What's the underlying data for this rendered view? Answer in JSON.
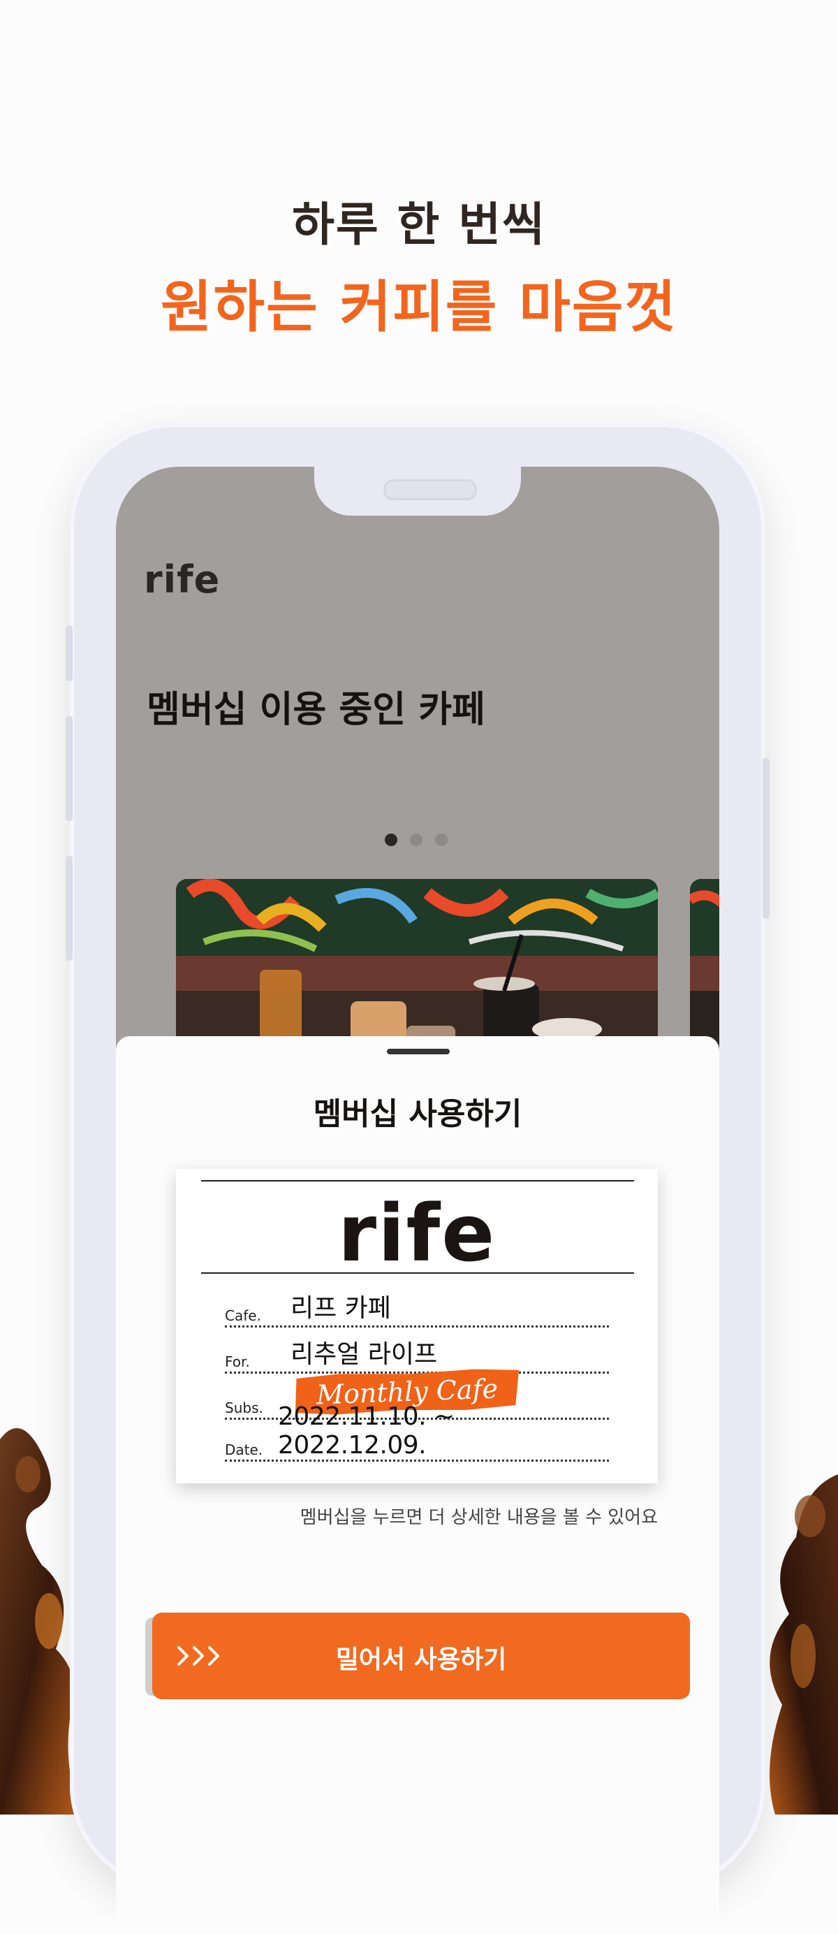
{
  "headline": {
    "line1": "하루 한 번씩",
    "line2": "원하는 커피를 마음껏"
  },
  "colors": {
    "accent": "#f2651e",
    "screen_bg": "#a29e9b",
    "phone_frame": "#e9e9f3"
  },
  "app": {
    "logo": "rife",
    "section_title": "멤버십 이용 중인 카페",
    "carousel": {
      "page_count": 3,
      "active_index": 0
    }
  },
  "sheet": {
    "title": "멤버십 사용하기",
    "ticket": {
      "logo": "rife",
      "rows": [
        {
          "label": "Cafe.",
          "value": "리프 카페"
        },
        {
          "label": "For.",
          "value": "리추얼 라이프"
        },
        {
          "label": "Subs.",
          "value": "Monthly Cafe"
        },
        {
          "label": "Date.",
          "value": "2022.11.10. ~ 2022.12.09."
        }
      ]
    },
    "hint": "멤버십을 누르면 더 상세한 내용을 볼 수 있어요",
    "slide_button": {
      "label": "밀어서 사용하기",
      "icon": "triple-chevron-right-icon"
    }
  }
}
